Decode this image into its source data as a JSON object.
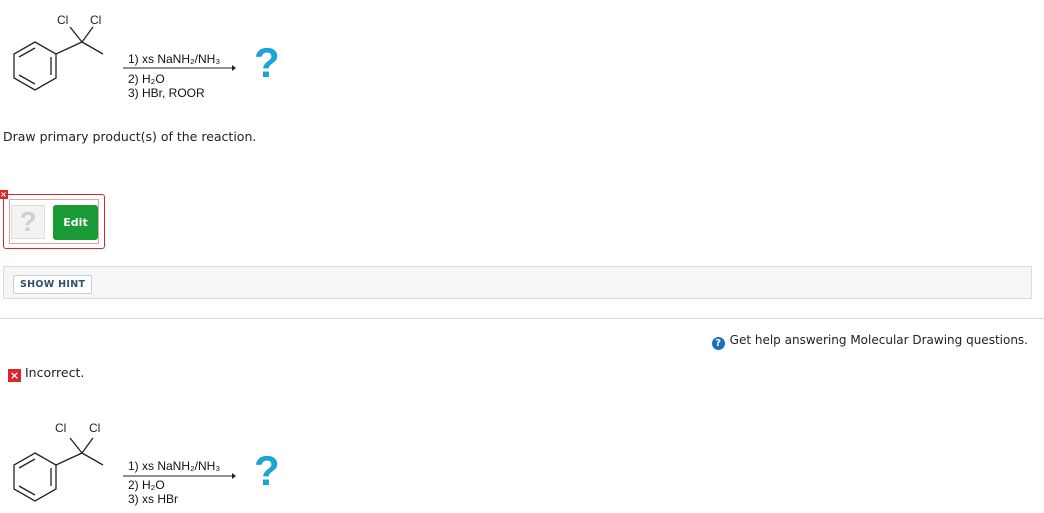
{
  "question": {
    "molecule_labels": [
      "Cl",
      "Cl"
    ],
    "reagents": [
      "1) xs NaNH₂/NH₃",
      "2) H₂O",
      "3) HBr, ROOR"
    ],
    "product_placeholder": "?",
    "prompt": "Draw primary product(s) of the reaction."
  },
  "answer": {
    "placeholder": "?",
    "edit_label": "Edit",
    "error_mark": "×"
  },
  "hint": {
    "button_label": "SHOW HINT"
  },
  "help": {
    "icon": "?",
    "label": "Get help answering Molecular Drawing questions."
  },
  "feedback": {
    "status_icon": "×",
    "status_label": "Incorrect.",
    "molecule_labels": [
      "Cl",
      "Cl"
    ],
    "reagents": [
      "1) xs NaNH₂/NH₃",
      "2) H₂O",
      "3) xs HBr"
    ],
    "product_placeholder": "?"
  }
}
